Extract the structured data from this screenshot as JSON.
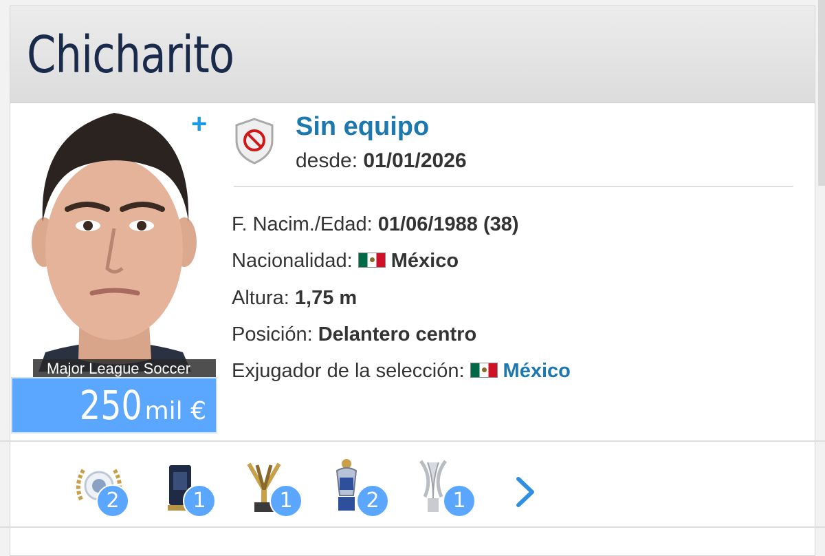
{
  "player": {
    "name": "Chicharito",
    "league_label": "Major League Soccer",
    "market_value_number": "250",
    "market_value_unit": "mil €"
  },
  "club": {
    "name": "Sin equipo",
    "since_label": "desde:",
    "since_value": "01/01/2026",
    "icon": "no-club-shield-icon"
  },
  "details": {
    "birth_label": "F. Nacim./Edad:",
    "birth_value": "01/06/1988 (38)",
    "nationality_label": "Nacionalidad:",
    "nationality_value": "México",
    "height_label": "Altura:",
    "height_value": "1,75 m",
    "position_label": "Posición:",
    "position_value": "Delantero centro",
    "national_label": "Exjugador de la selección:",
    "national_value": "México"
  },
  "trophies": [
    {
      "icon": "laurel-trophy-icon",
      "count": "2"
    },
    {
      "icon": "award-trophy-icon",
      "count": "1"
    },
    {
      "icon": "cup-trophy-icon",
      "count": "1"
    },
    {
      "icon": "premier-league-trophy-icon",
      "count": "2"
    },
    {
      "icon": "europa-trophy-icon",
      "count": "1"
    }
  ],
  "colors": {
    "accent": "#1d78b0",
    "value_box": "#5ba7ff",
    "title": "#1a2a4a"
  }
}
